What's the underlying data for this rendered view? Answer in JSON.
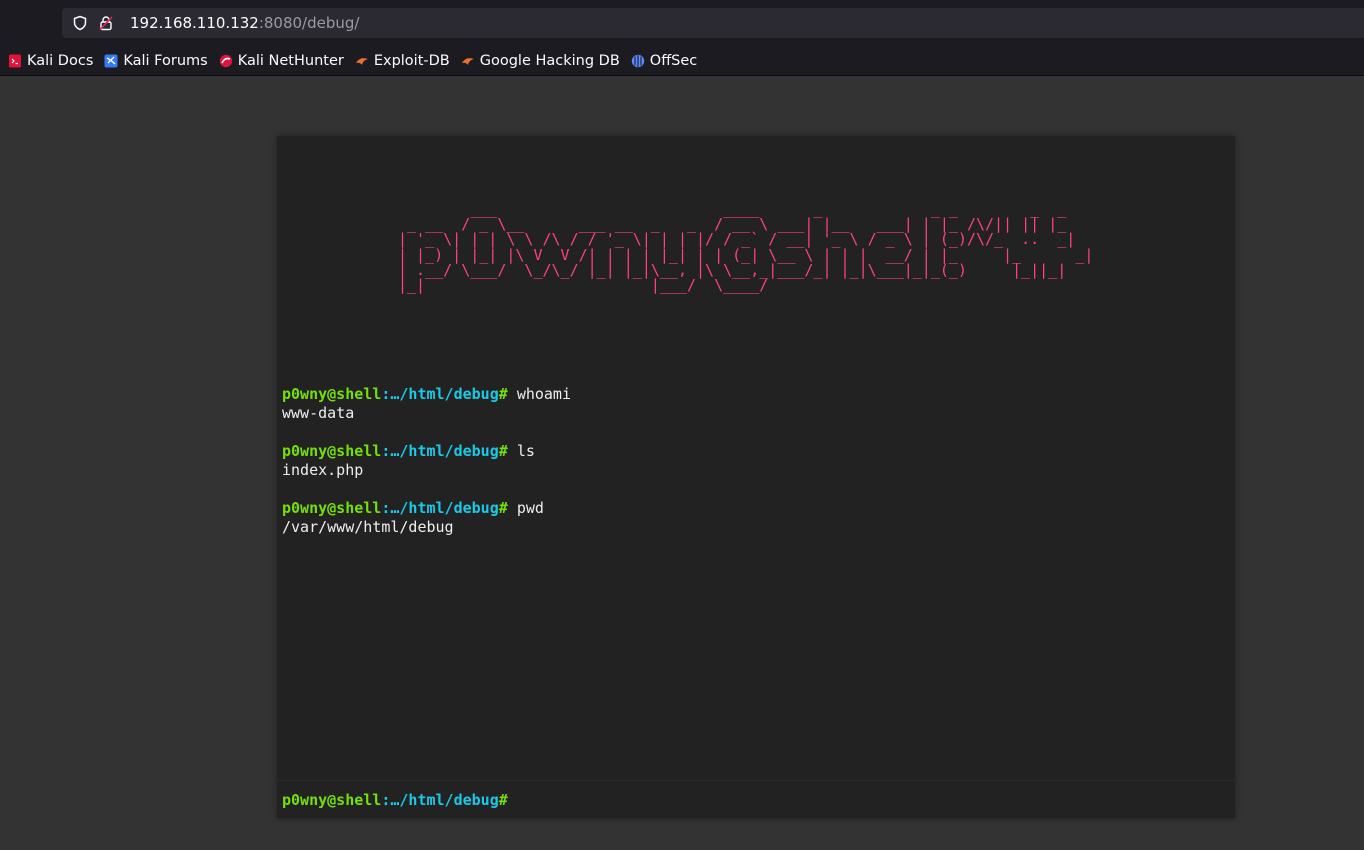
{
  "browser": {
    "url_host": "192.168.110.132",
    "url_rest": ":8080/debug/",
    "bookmarks": [
      {
        "label": "Kali Docs",
        "icon": "kali-docs-icon",
        "color": "#e0133a"
      },
      {
        "label": "Kali Forums",
        "icon": "kali-forums-icon",
        "color": "#367bf0"
      },
      {
        "label": "Kali NetHunter",
        "icon": "kali-nethunter-icon",
        "color": "#e0133a"
      },
      {
        "label": "Exploit-DB",
        "icon": "exploit-db-icon",
        "color": "#ec6f2c"
      },
      {
        "label": "Google Hacking DB",
        "icon": "google-hacking-db-icon",
        "color": "#ec6f2c"
      },
      {
        "label": "OffSec",
        "icon": "offsec-icon",
        "color": "#5b8cff"
      }
    ]
  },
  "shell": {
    "banner": "        ___                         ____      _            _ _        _  _\n _ __  / _ \\__      ___ __  _   _  / __ \\ ___| |__   ___| | |_ /\\/|| || |_\n| '_ \\| | | \\ \\ /\\ / / '_ \\| | | |/ / _` / __| '_ \\ / _ \\ | (_)/\\/_  ..  _|\n| |_) | |_| |\\ V  V /| | | | |_| | | (_| \\__ \\ | | |  __/ | |_     |_      _|\n| .__/ \\___/  \\_/\\_/ |_| |_|\\__, |\\ \\__,_|___/_| |_|\\___|_|_(_)     |_||_|\n|_|                         |___/  \\____/",
    "prompt": {
      "user": "p0wny@shell",
      "path": ":…/html/debug",
      "hash": "#"
    },
    "history": [
      {
        "command": "whoami",
        "output": "www-data"
      },
      {
        "command": "ls",
        "output": "index.php"
      },
      {
        "command": "pwd",
        "output": "/var/www/html/debug"
      }
    ],
    "input_value": ""
  },
  "colors": {
    "prompt_user": "#75df0b",
    "prompt_path": "#1bc9e7",
    "banner": "#ff4180",
    "background": "#222222"
  }
}
